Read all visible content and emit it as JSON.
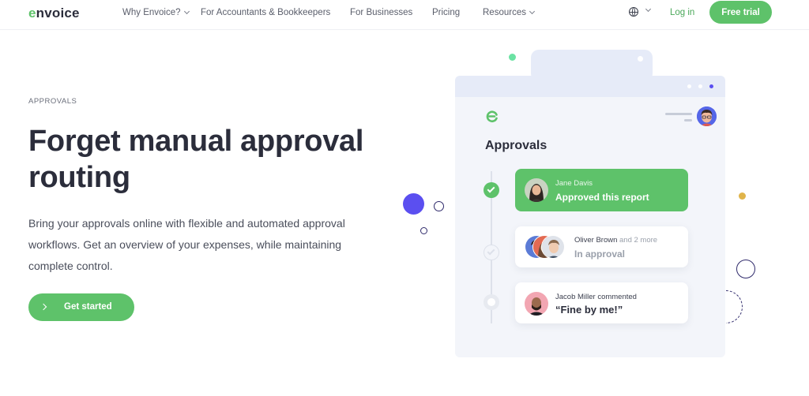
{
  "nav": {
    "logo": "envoice",
    "items": [
      {
        "label": "Why Envoice?",
        "dropdown": true
      },
      {
        "label": "For Accountants & Bookkeepers",
        "dropdown": false
      },
      {
        "label": "For Businesses",
        "dropdown": false
      },
      {
        "label": "Pricing",
        "dropdown": false
      },
      {
        "label": "Resources",
        "dropdown": true
      }
    ],
    "language_icon": "globe-icon",
    "login_label": "Log in",
    "trial_label": "Free trial"
  },
  "hero": {
    "eyebrow": "APPROVALS",
    "headline": "Forget manual approval routing",
    "body": "Bring your approvals online with flexible and automated approval workflows. Get an overview of your expenses, while maintaining complete control.",
    "cta_label": "Get started",
    "cta_icon": "chevron-right-icon"
  },
  "illustration": {
    "title": "Approvals",
    "entries": [
      {
        "name": "Jane Davis",
        "text": "Approved this report",
        "status": "approved"
      },
      {
        "name": "Oliver Brown",
        "name_suffix": "and 2 more",
        "text": "In approval",
        "status": "pending"
      },
      {
        "name": "Jacob Miller commented",
        "text": "“Fine by me!”",
        "status": "comment"
      }
    ]
  },
  "colors": {
    "brand_green": "#5ec26a",
    "accent_purple": "#5b4ff0",
    "accent_yellow": "#e0b44a",
    "accent_mint": "#6be2a3",
    "text_dark": "#2b2d3b",
    "card_bg": "#f3f5fa"
  }
}
